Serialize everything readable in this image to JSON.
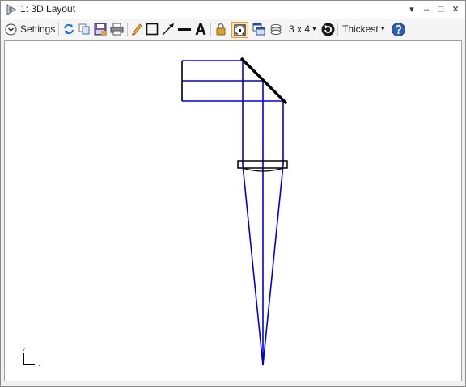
{
  "window": {
    "title": "1: 3D Layout",
    "controls": {
      "dropdown": "▾",
      "minimize": "–",
      "maximize": "□",
      "close": "✕"
    }
  },
  "toolbar": {
    "settings_label": "Settings",
    "grid_label": "3 x 4",
    "line_thickness_label": "Thickest"
  },
  "colors": {
    "ray": "#0000dd",
    "element": "#000000",
    "active_tool": "#fbe3b5"
  },
  "axis_indicator": {
    "y_label": "y",
    "z_label": "z"
  }
}
